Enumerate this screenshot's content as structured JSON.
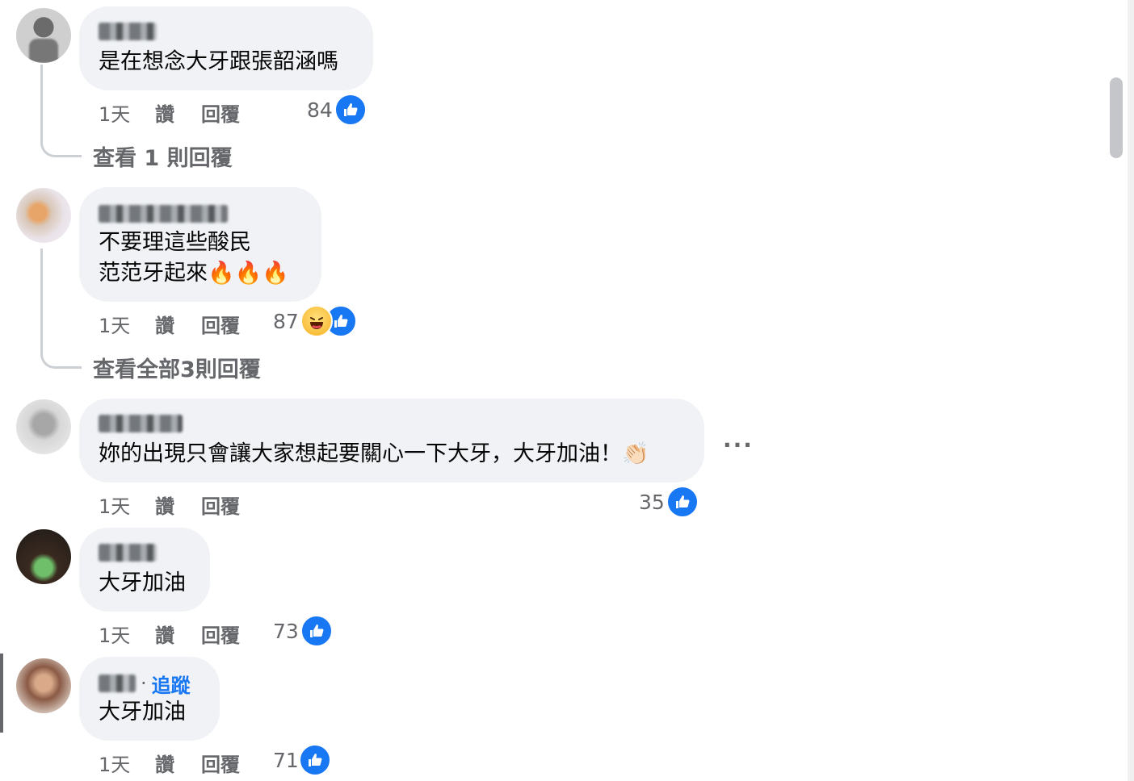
{
  "comments": [
    {
      "text_lines": [
        "是在想念大牙跟張韶涵嗎"
      ],
      "time": "1天",
      "like_label": "讚",
      "reply_label": "回覆",
      "reaction_count": "84",
      "view_replies": "查看 1 則回覆"
    },
    {
      "text_lines": [
        "不要理這些酸民",
        "范范牙起來🔥🔥🔥"
      ],
      "time": "1天",
      "like_label": "讚",
      "reply_label": "回覆",
      "reaction_count": "87",
      "view_replies": "查看全部3則回覆"
    },
    {
      "text_lines": [
        "妳的出現只會讓大家想起要關心一下大牙，大牙加油！👏🏻"
      ],
      "time": "1天",
      "like_label": "讚",
      "reply_label": "回覆",
      "reaction_count": "35"
    },
    {
      "text_lines": [
        "大牙加油"
      ],
      "time": "1天",
      "like_label": "讚",
      "reply_label": "回覆",
      "reaction_count": "73"
    },
    {
      "text_lines": [
        "大牙加油"
      ],
      "follow_label": "追蹤",
      "time": "1天",
      "like_label": "讚",
      "reply_label": "回覆",
      "reaction_count": "71"
    }
  ],
  "more_options": "···",
  "colors": {
    "like_blue": "#1877f2",
    "bubble_bg": "#f0f2f5",
    "secondary_text": "#65676b"
  },
  "icons": {
    "like": "like-icon",
    "haha": "haha-icon",
    "more": "more-options-icon"
  }
}
